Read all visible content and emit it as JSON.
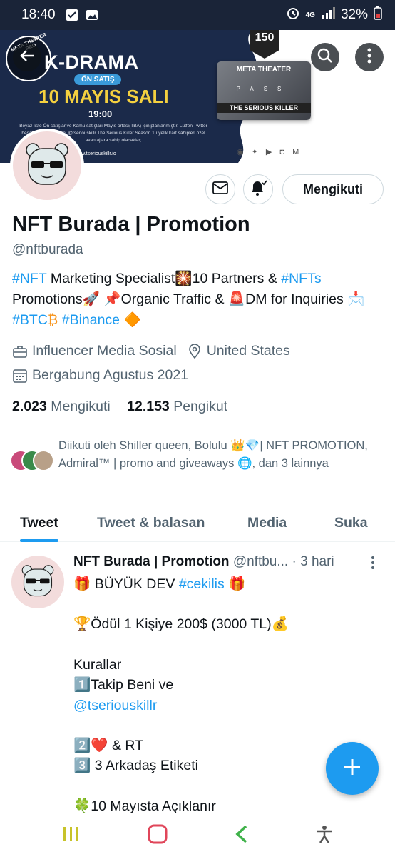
{
  "status_bar": {
    "time": "18:40",
    "network": "4G",
    "battery": "32%"
  },
  "banner": {
    "logo_text": "META THEATER PRO",
    "title": "K-DRAMA",
    "badge": "ÖN SATIŞ",
    "date": "10 MAYIS SALI",
    "hour": "19:00",
    "small_text": "Beyaz liste Ön satışlar ve Kamu satışları Mayıs ortası(TBA) için planlanmıştır. Lütfen Twitter hesabımızı takip edin, @tseriouskillr The Serious Killer Season 1 üyelik kart sahipleri özel avantajlara sahip olacaklar;",
    "site": "www.tseriouskillr.io",
    "pass_number": "150",
    "card_top": "META THEATER",
    "card_middle": "PASS",
    "card_bottom": "THE SERIOUS KILLER"
  },
  "profile": {
    "follow_label": "Mengikuti",
    "name": "NFT Burada | Promotion",
    "handle": "@nftburada",
    "bio": {
      "b1": "#NFT",
      "b2": " Marketing Specialist🎇10 Partners & ",
      "b3": "#NFTs",
      "b4": " Promotions🚀  📌Organic Traffic & 🚨DM for Inquiries 📩 ",
      "b5": "#BTC",
      "b6": "₿  ",
      "b7": "#Binance",
      "b8": " 🔶"
    },
    "category": "Influencer Media Sosial",
    "location": "United States",
    "joined": "Bergabung Agustus 2021",
    "following_count": "2.023",
    "following_label": "Mengikuti",
    "followers_count": "12.153",
    "followers_label": "Pengikut",
    "followed_by": "Diikuti oleh Shiller queen, Bolulu 👑💎| NFT PROMOTION, Admiral™ | promo and giveaways 🌐, dan 3 lainnya"
  },
  "tabs": [
    "Tweet",
    "Tweet & balasan",
    "Media",
    "Suka"
  ],
  "tweet": {
    "name": "NFT Burada | Promotion",
    "handle": "@nftbu...",
    "time": "· 3 hari",
    "line1a": "🎁 BÜYÜK DEV ",
    "line1b": "#cekilis",
    "line1c": " 🎁",
    "line2": "🏆Ödül 1 Kişiye 200$ (3000 TL)💰",
    "line3": "Kurallar",
    "line4": "1️⃣Takip Beni ve",
    "line5": "@tseriouskillr",
    "line6": "2️⃣❤️ & RT",
    "line7": "3️⃣ 3 Arkadaş Etiketi",
    "line8": "🍀10 Mayısta Açıklanır"
  },
  "colors": {
    "accent": "#1d9bf0",
    "text": "#0f1419",
    "secondary": "#536471"
  }
}
